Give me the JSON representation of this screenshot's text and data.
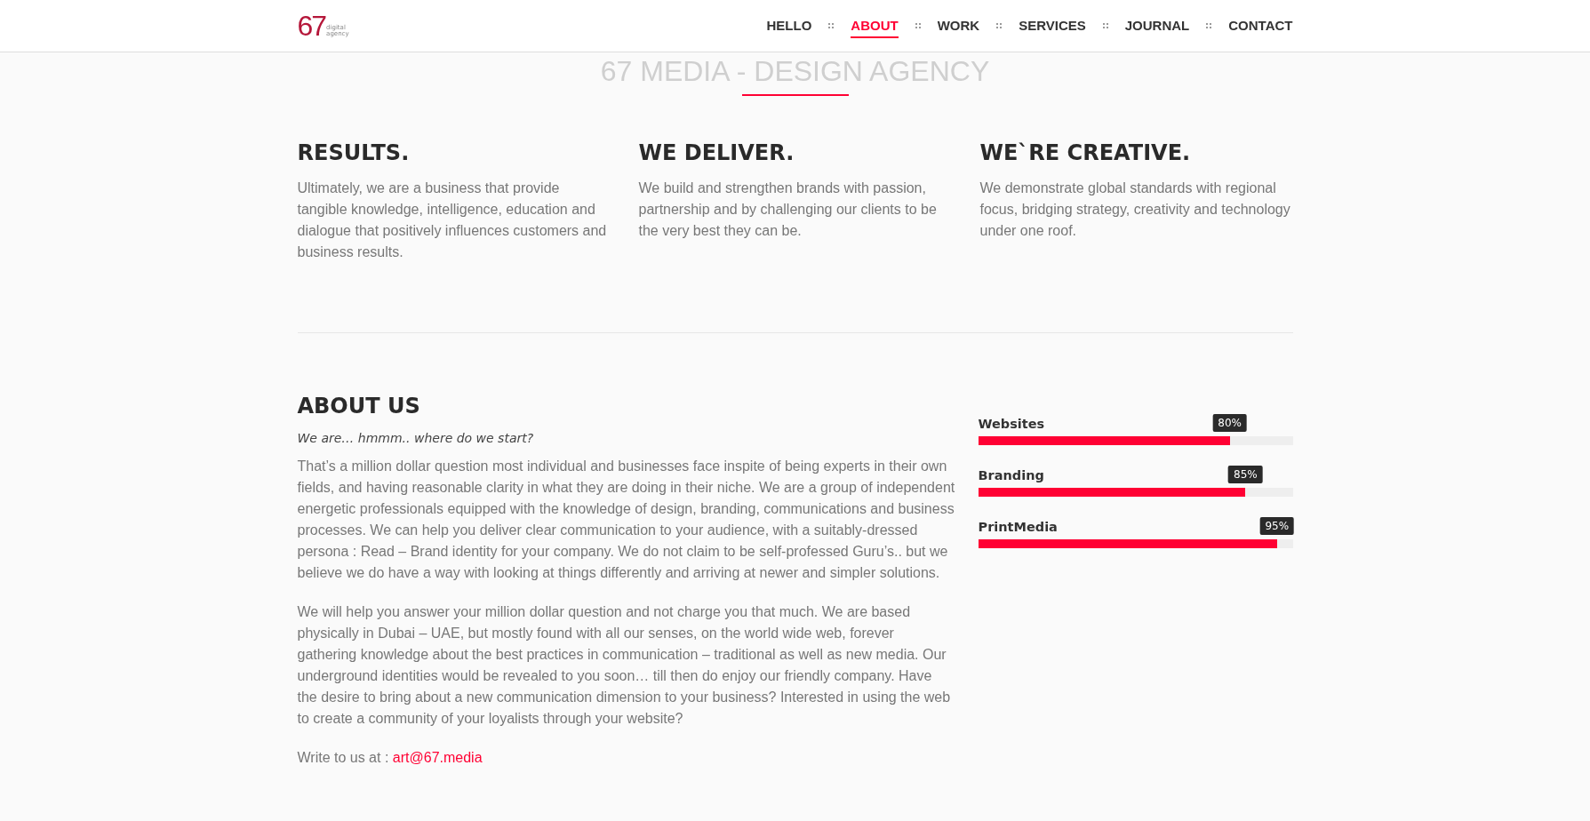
{
  "logo": {
    "mark": "67",
    "tagline": "digital agency"
  },
  "nav": [
    {
      "label": "HELLO",
      "selected": false
    },
    {
      "label": "ABOUT",
      "selected": true
    },
    {
      "label": "WORK",
      "selected": false
    },
    {
      "label": "SERVICES",
      "selected": false
    },
    {
      "label": "JOURNAL",
      "selected": false
    },
    {
      "label": "CONTACT",
      "selected": false
    }
  ],
  "page_title": "67 MEDIA - DESIGN AGENCY",
  "features": [
    {
      "title": "RESULTS.",
      "text": "Ultimately, we are a business that provide tangible knowledge, intelligence, education and dialogue that positively influences customers and business results."
    },
    {
      "title": "WE DELIVER.",
      "text": "We build and strengthen brands with passion, partnership and by challenging our clients to be the very best they can be."
    },
    {
      "title": "WE`RE CREATIVE.",
      "text": "We demonstrate global standards with regional focus, bridging strategy, creativity and technology under one roof."
    }
  ],
  "about": {
    "title": "ABOUT US",
    "subtitle": "We are… hmmm.. where do we start?",
    "paragraphs": [
      "That’s a million dollar question most individual and businesses face inspite of being experts in their own fields, and having reasonable clarity in what they are doing in their niche. We are a group of independent energetic professionals equipped with the knowledge of design, branding, communications and business processes. We can help you deliver clear communication to your audience, with a suitably-dressed persona : Read – Brand identity for your company. We do not claim to be self-professed Guru’s.. but we believe we do have a way with looking at things differently and arriving at newer and simpler solutions.",
      "We will help you answer your million dollar question and not charge you that much. We are based physically in Dubai – UAE, but mostly found with all our senses, on the world wide web, forever gathering knowledge about the best practices in communication – traditional as well as new media. Our underground identities would be revealed to you soon… till then do enjoy our friendly company. Have the desire to bring about a new communication dimension to your business? Interested in using the web to create a community of your loyalists through your website?"
    ],
    "contact_label": "Write to us at :",
    "contact_email": "art@67.media"
  },
  "skills": [
    {
      "name": "Websites",
      "level": 0.8,
      "reading": "80%"
    },
    {
      "name": "Branding",
      "level": 0.85,
      "reading": "85%"
    },
    {
      "name": "PrintMedia",
      "level": 0.95,
      "reading": "95%"
    }
  ]
}
